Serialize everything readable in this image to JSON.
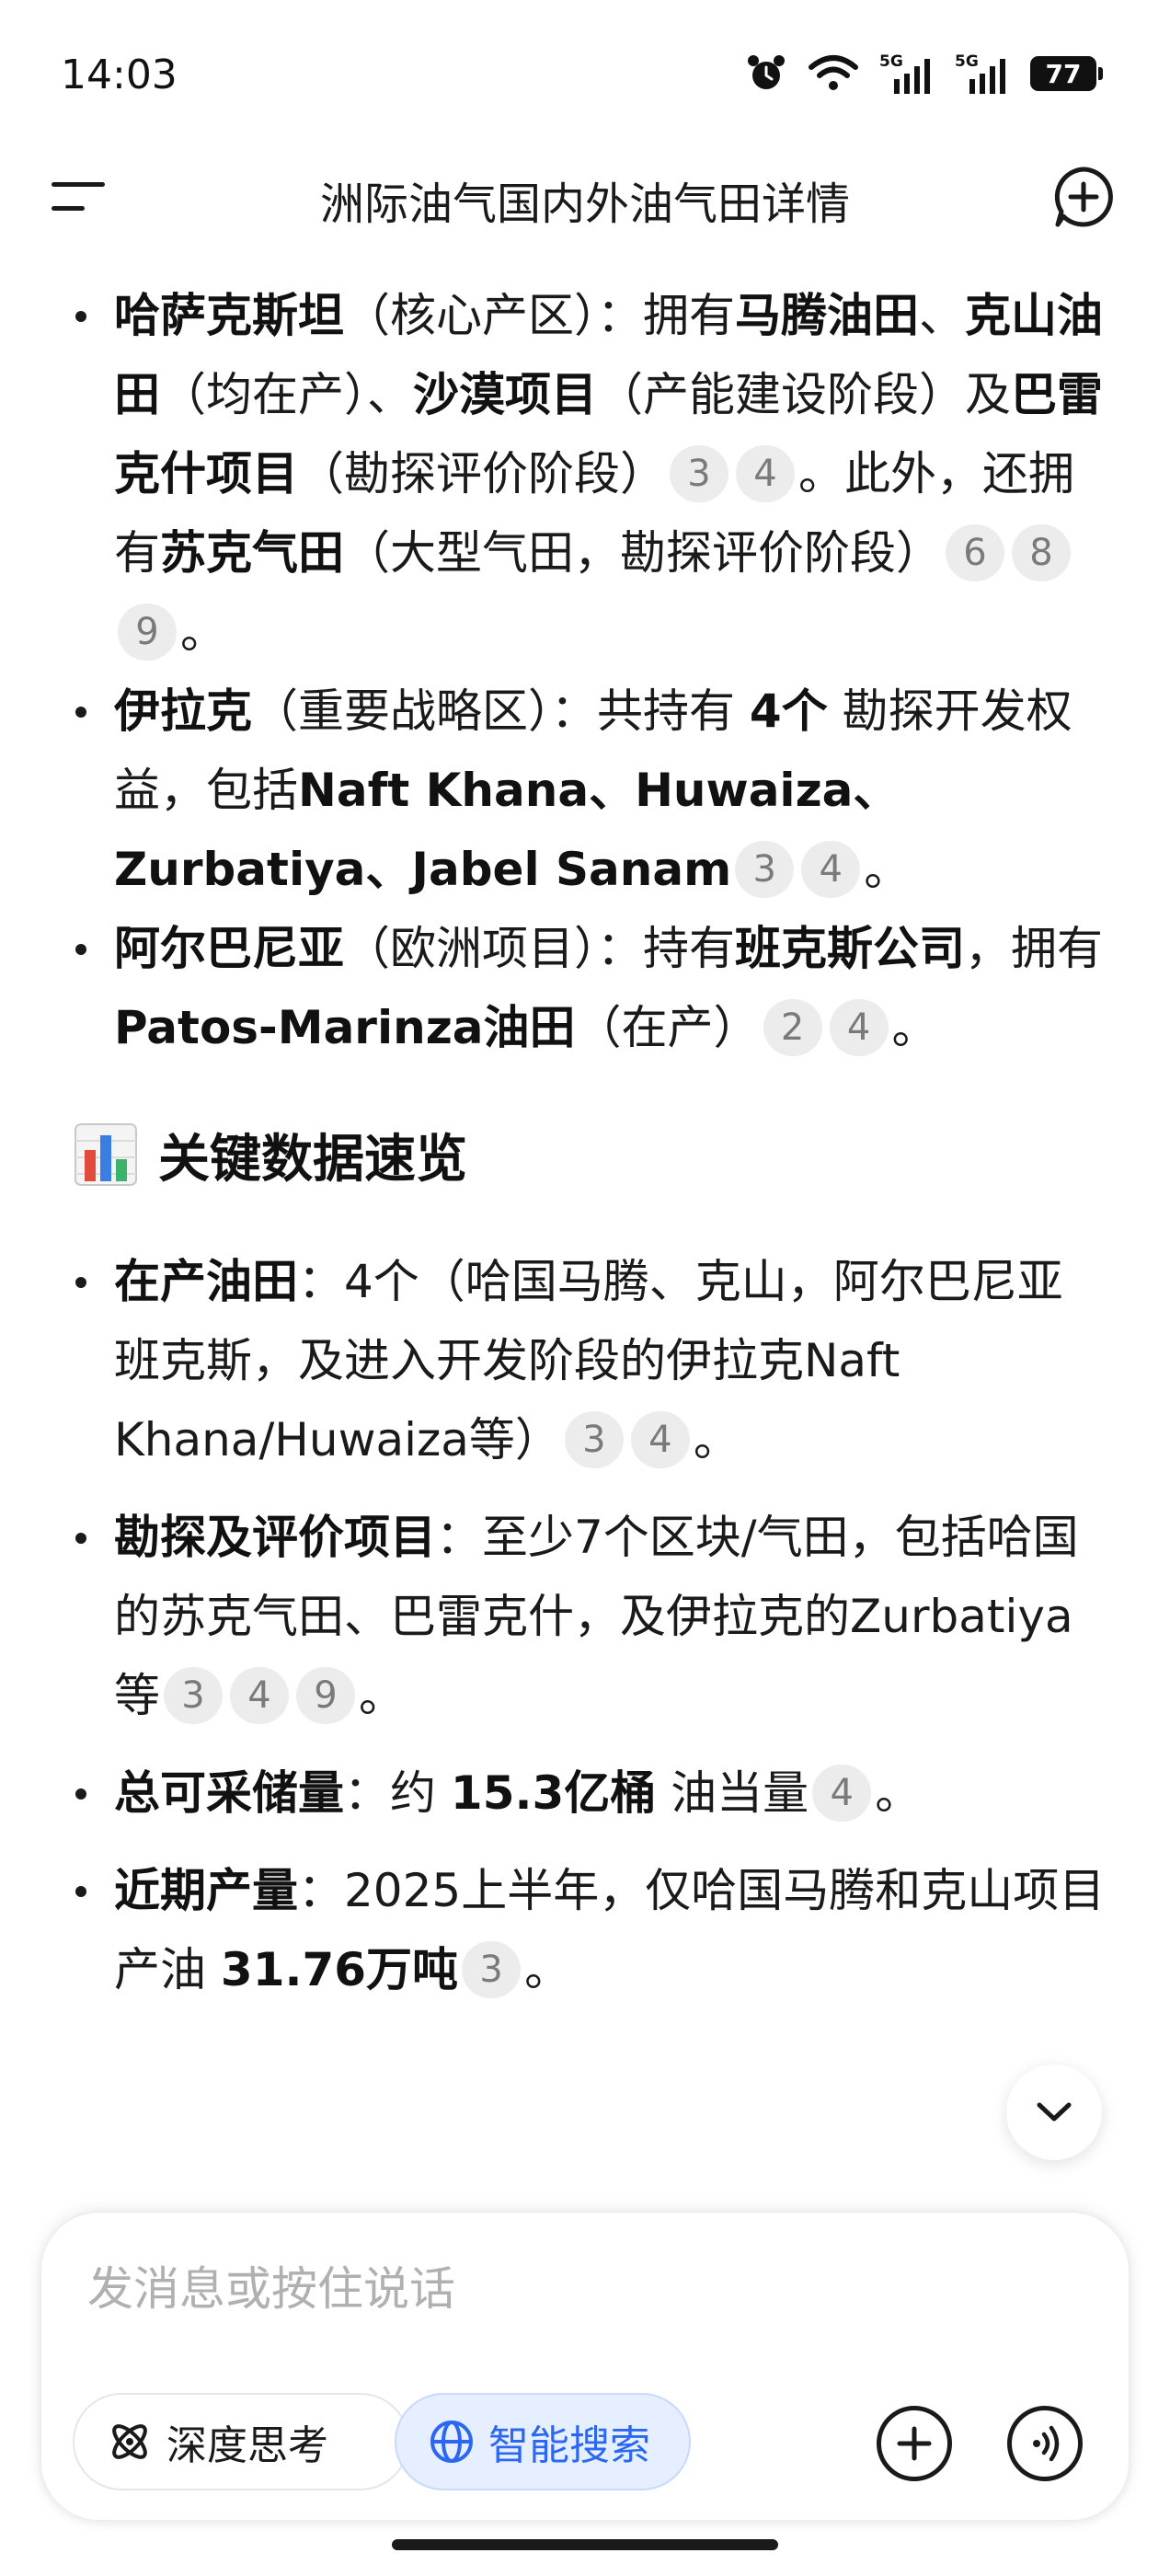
{
  "status": {
    "time": "14:03",
    "net1": "5G",
    "net2": "5G",
    "battery": "77"
  },
  "header": {
    "title": "洲际油气国内外油气田详情"
  },
  "list1": [
    {
      "country": "哈萨克斯坦",
      "note": "（核心产区）：拥有",
      "f1": "马腾油田",
      "t1": "、",
      "f2": "克山油田",
      "t2": "（均在产）、",
      "f3": "沙漠项目",
      "t3": "（产能建设阶段）及",
      "f4": "巴雷克什项目",
      "t4": "（勘探评价阶段）",
      "cites_a": [
        "3",
        "4"
      ],
      "t5": "。此外，还拥有",
      "f5": "苏克气田",
      "t6": "（大型气田，勘探评价阶段）",
      "cites_b": [
        "6",
        "8",
        "9"
      ],
      "end": "。"
    },
    {
      "country": "伊拉克",
      "note": "（重要战略区）：共持有 ",
      "count": "4个",
      "t1": " 勘探开发权益，包括",
      "fields": "Naft Khana、Huwaiza、Zurbatiya、Jabel Sanam",
      "cites": [
        "3",
        "4"
      ],
      "end": "。"
    },
    {
      "country": "阿尔巴尼亚",
      "note": "（欧洲项目）：持有",
      "company": "班克斯公司",
      "t1": "，拥有",
      "field": "Patos-Marinza油田",
      "t2": "（在产）",
      "cites": [
        "2",
        "4"
      ],
      "end": "。"
    }
  ],
  "section": {
    "icon": "bar-chart-icon",
    "title": "关键数据速览"
  },
  "list2": [
    {
      "label": "在产油田",
      "text": "：4个（哈国马腾、克山，阿尔巴尼亚班克斯，及进入开发阶段的伊拉克Naft Khana/Huwaiza等）",
      "cites": [
        "3",
        "4"
      ],
      "end": "。"
    },
    {
      "label": "勘探及评价项目",
      "text": "：至少7个区块/气田，包括哈国的苏克气田、巴雷克什，及伊拉克的Zurbatiya等",
      "cites": [
        "3",
        "4",
        "9"
      ],
      "end": "。"
    },
    {
      "label": "总可采储量",
      "pre": "：约 ",
      "value": "15.3亿桶",
      "text": " 油当量",
      "cites": [
        "4"
      ],
      "end": "。"
    },
    {
      "label": "近期产量",
      "pre": "：2025上半年，仅哈国马腾和克山项目产油 ",
      "value": "31.76万吨",
      "cites": [
        "3"
      ],
      "end": "。"
    }
  ],
  "input": {
    "placeholder": "发消息或按住说话"
  },
  "chips": {
    "deep_think": "深度思考",
    "smart_search": "智能搜索"
  },
  "colors": {
    "accent": "#2b67f2",
    "chip_bg": "#e6efff",
    "cite_bg": "#ececec"
  }
}
